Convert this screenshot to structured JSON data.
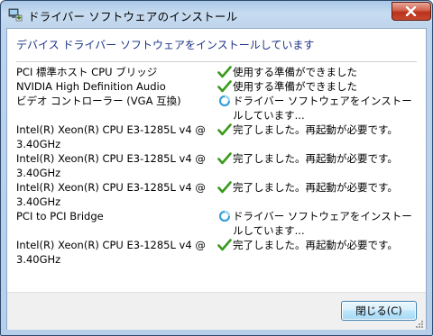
{
  "window": {
    "title": "ドライバー ソフトウェアのインストール"
  },
  "header": {
    "text": "デバイス ドライバー ソフトウェアをインストールしています"
  },
  "devices": [
    {
      "name": "PCI 標準ホスト CPU ブリッジ",
      "status": "使用する準備ができました",
      "icon": "check-icon"
    },
    {
      "name": "NVIDIA High Definition Audio",
      "status": "使用する準備ができました",
      "icon": "check-icon"
    },
    {
      "name": "ビデオ コントローラー (VGA 互換)",
      "status": "ドライバー ソフトウェアをインストールしています...",
      "icon": "busy-icon"
    },
    {
      "name": "Intel(R) Xeon(R) CPU E3-1285L v4 @ 3.40GHz",
      "status": "完了しました。再起動が必要です。",
      "icon": "check-icon"
    },
    {
      "name": "Intel(R) Xeon(R) CPU E3-1285L v4 @ 3.40GHz",
      "status": "完了しました。再起動が必要です。",
      "icon": "check-icon"
    },
    {
      "name": "Intel(R) Xeon(R) CPU E3-1285L v4 @ 3.40GHz",
      "status": "完了しました。再起動が必要です。",
      "icon": "check-icon"
    },
    {
      "name": "PCI to PCI Bridge",
      "status": "ドライバー ソフトウェアをインストールしています...",
      "icon": "busy-icon"
    },
    {
      "name": "Intel(R) Xeon(R) CPU E3-1285L v4 @ 3.40GHz",
      "status": "完了しました。再起動が必要です。",
      "icon": "check-icon"
    }
  ],
  "footer": {
    "close_label": "閉じる(C)"
  },
  "colors": {
    "header_text": "#1e3287",
    "check": "#3a9a1c",
    "busy": "#3aa0d8"
  }
}
